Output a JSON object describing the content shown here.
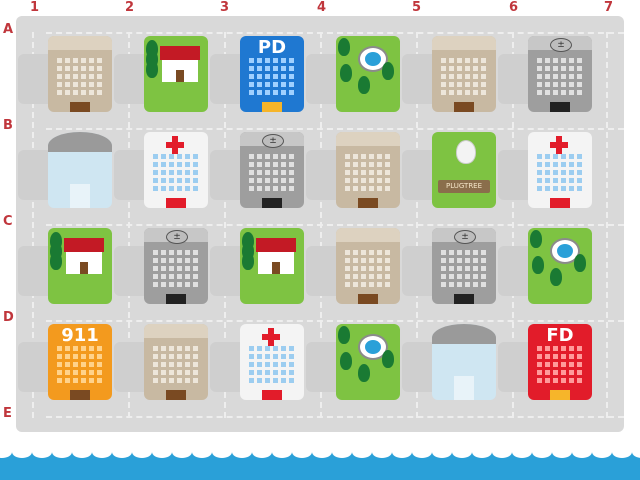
{
  "columns": [
    "1",
    "2",
    "3",
    "4",
    "5",
    "6",
    "7"
  ],
  "rows": [
    "A",
    "B",
    "C",
    "D",
    "E"
  ],
  "labels": {
    "pd": "PD",
    "fd": "FD",
    "911": "911",
    "plugtree": "PLUGTREE"
  },
  "colors": {
    "board": "#d9d9d9",
    "sea": "#2aa0d8",
    "park": "#7ec342",
    "red": "#e21c2a",
    "blue": "#1f78d1",
    "orange": "#f39a1e",
    "beige": "#c8b9a2",
    "gray": "#9e9e9e"
  },
  "grid": [
    [
      "office",
      "house",
      "police",
      "park",
      "office",
      "power"
    ],
    [
      "dome",
      "hospital",
      "power",
      "office",
      "plugtree",
      "hospital"
    ],
    [
      "house",
      "power",
      "house",
      "office",
      "power",
      "park"
    ],
    [
      "emergency",
      "office",
      "hospital",
      "park",
      "dome",
      "fire"
    ]
  ]
}
